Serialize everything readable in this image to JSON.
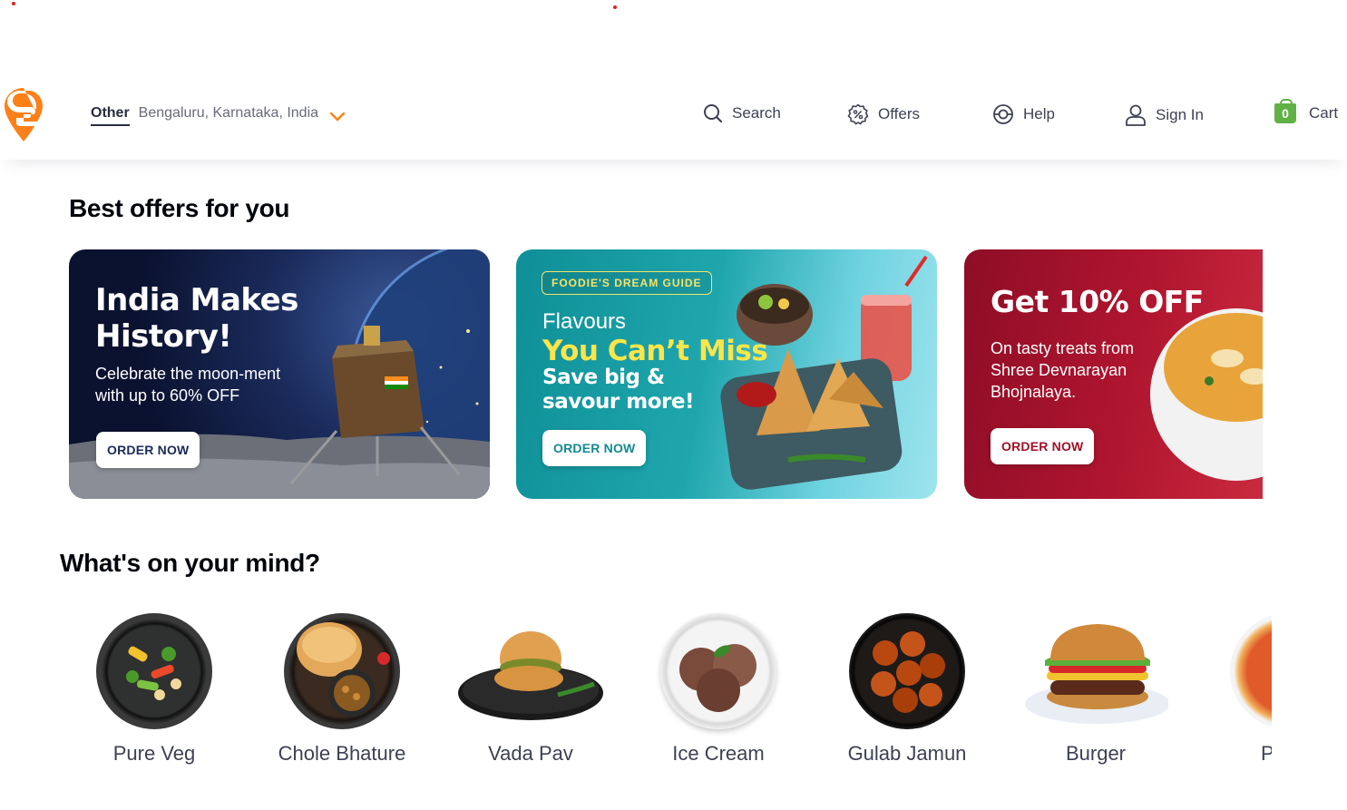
{
  "header": {
    "location_type": "Other",
    "location_address": "Bengaluru, Karnataka, India",
    "nav": {
      "search": "Search",
      "offers": "Offers",
      "help": "Help",
      "sign_in": "Sign In",
      "cart": "Cart",
      "cart_count": "0"
    },
    "brand_color": "#fc8019"
  },
  "offers_section": {
    "title": "Best offers for you",
    "cards": [
      {
        "title_line1": "India Makes",
        "title_line2": "History!",
        "subtitle_line1": "Celebrate the moon-ment",
        "subtitle_line2": "with up to 60% OFF",
        "cta": "ORDER NOW"
      },
      {
        "tag": "FOODIE'S DREAM GUIDE",
        "line1": "Flavours",
        "line2": "You Can’t Miss",
        "line3": "Save big &",
        "line4": "savour more!",
        "cta": "ORDER NOW"
      },
      {
        "title": "Get 10% OFF",
        "subtitle_line1": "On tasty treats from",
        "subtitle_line2": "Shree Devnarayan",
        "subtitle_line3": "Bhojnalaya.",
        "cta": "ORDER NOW"
      }
    ]
  },
  "mind_section": {
    "title": "What's on your mind?",
    "items": [
      {
        "label": "Pure Veg",
        "icon": "pure-veg-dish"
      },
      {
        "label": "Chole Bhature",
        "icon": "chole-bhature-dish"
      },
      {
        "label": "Vada Pav",
        "icon": "vada-pav-dish"
      },
      {
        "label": "Ice Cream",
        "icon": "ice-cream-dish"
      },
      {
        "label": "Gulab Jamun",
        "icon": "gulab-jamun-dish"
      },
      {
        "label": "Burger",
        "icon": "burger-dish"
      },
      {
        "label": "P",
        "icon": "pizza-dish"
      }
    ]
  }
}
